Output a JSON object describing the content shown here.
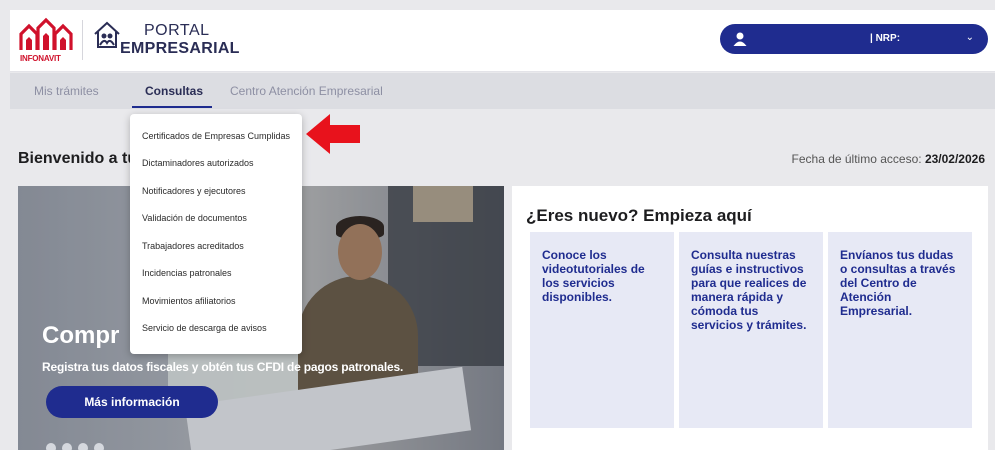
{
  "header": {
    "brand_infonavit": "INFONAVIT",
    "portal_line1": "PORTAL",
    "portal_line2": "EMPRESARIAL",
    "user_nrp_label": "| NRP:",
    "user_icon": "user-icon",
    "chevron_icon": "chevron-down-icon"
  },
  "nav": {
    "tabs": [
      {
        "label": "Mis trámites"
      },
      {
        "label": "Consultas"
      },
      {
        "label": "Centro Atención Empresarial"
      }
    ]
  },
  "dropdown": {
    "items": [
      {
        "label": "Certificados de Empresas Cumplidas"
      },
      {
        "label": "Dictaminadores autorizados"
      },
      {
        "label": "Notificadores y ejecutores"
      },
      {
        "label": "Validación de documentos"
      },
      {
        "label": "Trabajadores acreditados"
      },
      {
        "label": "Incidencias patronales"
      },
      {
        "label": "Movimientos afiliatorios"
      },
      {
        "label": "Servicio de descarga de avisos"
      }
    ]
  },
  "main": {
    "welcome_text": "Bienvenido a tu",
    "last_access_label": "Fecha de último acceso:",
    "last_access_date": "23/02/2026"
  },
  "banner": {
    "title": "Compr",
    "subtitle": "Registra tus datos fiscales y obtén tus CFDI de pagos patronales.",
    "cta_label": "Más información"
  },
  "panel": {
    "title": "¿Eres nuevo? Empieza aquí",
    "cards": [
      {
        "text": "Conoce los videotutoriales de los servicios disponibles."
      },
      {
        "text": "Consulta nuestras guías e instructivos para que realices de manera rápida y cómoda tus servicios y trámites."
      },
      {
        "text": "Envíanos tus dudas o consultas a través del Centro de Atención Empresarial."
      }
    ]
  },
  "colors": {
    "brand_blue": "#1f2c8f",
    "infonavit_red": "#d0112b",
    "highlight_arrow": "#e8121c"
  }
}
